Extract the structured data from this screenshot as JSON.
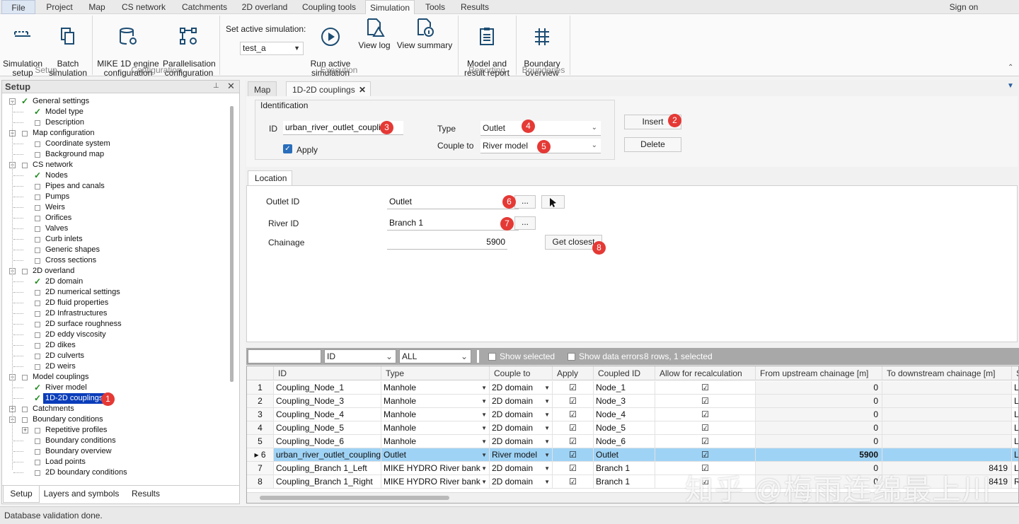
{
  "menu": {
    "file": "File",
    "tabs": [
      "Project",
      "Map",
      "CS network",
      "Catchments",
      "2D overland",
      "Coupling tools",
      "Simulation",
      "Tools",
      "Results"
    ],
    "sign_on": "Sign on"
  },
  "ribbon": {
    "sim_setup": "Simulation\nsetup",
    "batch": "Batch\nsimulation",
    "group_setup": "Setup",
    "mike1d": "MIKE 1D engine\nconfiguration",
    "parallel": "Parallelisation\nconfiguration",
    "group_config": "Configuration",
    "set_active_label": "Set active simulation:",
    "active_sim": "test_a",
    "run": "Run active\nsimulation",
    "view_log": "View log",
    "view_summary": "View summary",
    "group_exec": "Execution",
    "report": "Model and\nresult report",
    "group_reporting": "Reporting",
    "boundary": "Boundary\noverview",
    "group_boundaries": "Boundaries"
  },
  "left_panel": {
    "title": "Setup",
    "tree": [
      {
        "label": "General settings",
        "level": 0,
        "check": true,
        "exp": "-"
      },
      {
        "label": "Model type",
        "level": 1,
        "check": true
      },
      {
        "label": "Description",
        "level": 1,
        "check": false
      },
      {
        "label": "Map configuration",
        "level": 0,
        "check": false,
        "exp": "-"
      },
      {
        "label": "Coordinate system",
        "level": 1,
        "check": false
      },
      {
        "label": "Background map",
        "level": 1,
        "check": false
      },
      {
        "label": "CS network",
        "level": 0,
        "check": false,
        "exp": "-"
      },
      {
        "label": "Nodes",
        "level": 1,
        "check": true
      },
      {
        "label": "Pipes and canals",
        "level": 1,
        "check": false
      },
      {
        "label": "Pumps",
        "level": 1,
        "check": false
      },
      {
        "label": "Weirs",
        "level": 1,
        "check": false
      },
      {
        "label": "Orifices",
        "level": 1,
        "check": false
      },
      {
        "label": "Valves",
        "level": 1,
        "check": false
      },
      {
        "label": "Curb inlets",
        "level": 1,
        "check": false
      },
      {
        "label": "Generic shapes",
        "level": 1,
        "check": false
      },
      {
        "label": "Cross sections",
        "level": 1,
        "check": false
      },
      {
        "label": "2D overland",
        "level": 0,
        "check": false,
        "exp": "-"
      },
      {
        "label": "2D domain",
        "level": 1,
        "check": true
      },
      {
        "label": "2D numerical settings",
        "level": 1,
        "check": false
      },
      {
        "label": "2D fluid properties",
        "level": 1,
        "check": false
      },
      {
        "label": "2D Infrastructures",
        "level": 1,
        "check": false
      },
      {
        "label": "2D surface roughness",
        "level": 1,
        "check": false
      },
      {
        "label": "2D eddy viscosity",
        "level": 1,
        "check": false
      },
      {
        "label": "2D dikes",
        "level": 1,
        "check": false
      },
      {
        "label": "2D culverts",
        "level": 1,
        "check": false
      },
      {
        "label": "2D weirs",
        "level": 1,
        "check": false
      },
      {
        "label": "Model couplings",
        "level": 0,
        "check": false,
        "exp": "-"
      },
      {
        "label": "River model",
        "level": 1,
        "check": true
      },
      {
        "label": "1D-2D couplings",
        "level": 1,
        "check": true,
        "selected": true
      },
      {
        "label": "Catchments",
        "level": 0,
        "check": false,
        "exp": "+"
      },
      {
        "label": "Boundary conditions",
        "level": 0,
        "check": false,
        "exp": "-"
      },
      {
        "label": "Repetitive profiles",
        "level": 1,
        "check": false,
        "exp": "+"
      },
      {
        "label": "Boundary conditions",
        "level": 1,
        "check": false
      },
      {
        "label": "Boundary overview",
        "level": 1,
        "check": false
      },
      {
        "label": "Load points",
        "level": 1,
        "check": false
      },
      {
        "label": "2D boundary conditions",
        "level": 1,
        "check": false
      }
    ],
    "bottom_tabs": [
      "Setup",
      "Layers and symbols",
      "Results"
    ]
  },
  "doc_tabs": {
    "map": "Map",
    "couplings": "1D-2D couplings"
  },
  "identification": {
    "title": "Identification",
    "id_label": "ID",
    "id_value": "urban_river_outlet_coupling",
    "apply_label": "Apply",
    "type_label": "Type",
    "type_value": "Outlet",
    "couple_label": "Couple to",
    "couple_value": "River model",
    "insert": "Insert",
    "delete": "Delete"
  },
  "location": {
    "tab": "Location",
    "outlet_label": "Outlet ID",
    "outlet_value": "Outlet",
    "river_label": "River ID",
    "river_value": "Branch 1",
    "chainage_label": "Chainage",
    "chainage_value": "5900",
    "browse": "...",
    "get_closest": "Get closest"
  },
  "badges": [
    "1",
    "2",
    "3",
    "4",
    "5",
    "6",
    "7",
    "8"
  ],
  "filter": {
    "field": "ID",
    "scope": "ALL",
    "show_selected": "Show selected",
    "show_errors": "Show data errors",
    "summary": "8 rows, 1 selected"
  },
  "grid": {
    "columns": [
      "ID",
      "Type",
      "Couple to",
      "Apply",
      "Coupled ID",
      "Allow for recalculation",
      "From upstream chainage [m]",
      "To downstream chainage [m]",
      "S"
    ],
    "rows": [
      {
        "n": "1",
        "id": "Coupling_Node_1",
        "type": "Manhole",
        "couple": "2D domain",
        "coupled": "Node_1",
        "from": "0",
        "to": "",
        "s": "L"
      },
      {
        "n": "2",
        "id": "Coupling_Node_3",
        "type": "Manhole",
        "couple": "2D domain",
        "coupled": "Node_3",
        "from": "0",
        "to": "",
        "s": "L"
      },
      {
        "n": "3",
        "id": "Coupling_Node_4",
        "type": "Manhole",
        "couple": "2D domain",
        "coupled": "Node_4",
        "from": "0",
        "to": "",
        "s": "L"
      },
      {
        "n": "4",
        "id": "Coupling_Node_5",
        "type": "Manhole",
        "couple": "2D domain",
        "coupled": "Node_5",
        "from": "0",
        "to": "",
        "s": "L"
      },
      {
        "n": "5",
        "id": "Coupling_Node_6",
        "type": "Manhole",
        "couple": "2D domain",
        "coupled": "Node_6",
        "from": "0",
        "to": "",
        "s": "L"
      },
      {
        "n": "6",
        "id": "urban_river_outlet_coupling",
        "type": "Outlet",
        "couple": "River model",
        "coupled": "Outlet",
        "from": "5900",
        "to": "",
        "s": "L",
        "selected": true
      },
      {
        "n": "7",
        "id": "Coupling_Branch 1_Left",
        "type": "MIKE HYDRO River bank",
        "couple": "2D domain",
        "coupled": "Branch 1",
        "from": "0",
        "to": "8419",
        "s": "L"
      },
      {
        "n": "8",
        "id": "Coupling_Branch 1_Right",
        "type": "MIKE HYDRO River bank",
        "couple": "2D domain",
        "coupled": "Branch 1",
        "from": "0",
        "to": "8419",
        "s": "R"
      }
    ]
  },
  "status": "Database validation done.",
  "watermark": "知乎 @梅雨连绵最上川"
}
